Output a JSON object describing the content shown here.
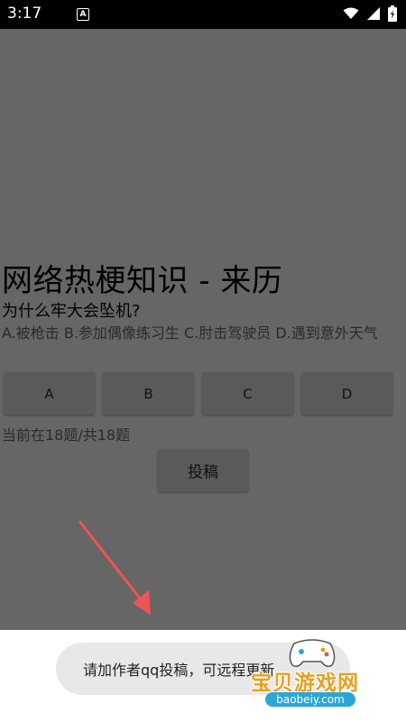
{
  "status_bar": {
    "time": "3:17",
    "notification_letter": "A"
  },
  "quiz": {
    "title": "网络热梗知识 - 来历",
    "question": "为什么牢大会坠机?",
    "options_text": "A.被枪击  B.参加偶像练习生  C.肘击驾驶员  D.遇到意外天气",
    "answers": [
      {
        "label": "A"
      },
      {
        "label": "B"
      },
      {
        "label": "C"
      },
      {
        "label": "D"
      }
    ],
    "progress": "当前在18题/共18题",
    "submit_label": "投稿"
  },
  "toast": {
    "message": "请加作者qq投稿，可远程更新..."
  },
  "watermark": {
    "text": "宝贝游戏网",
    "url": "baobeiy.com"
  },
  "colors": {
    "overlay_background": "#666666",
    "arrow": "#ee5555",
    "watermark_text": "#e8a020",
    "watermark_url_bg": "#2aa7d8"
  }
}
